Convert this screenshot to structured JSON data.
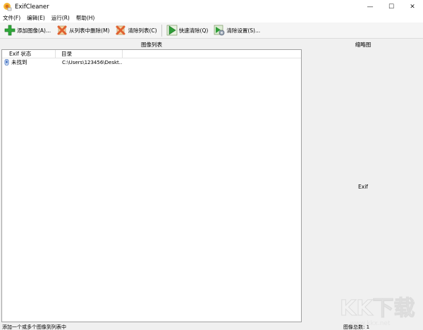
{
  "window": {
    "title": "ExifCleaner",
    "controls": {
      "minimize": "—",
      "maximize": "☐",
      "close": "✕"
    }
  },
  "menu": {
    "items": [
      {
        "label": "文件(F)"
      },
      {
        "label": "编辑(E)"
      },
      {
        "label": "运行(R)"
      },
      {
        "label": "帮助(H)"
      }
    ]
  },
  "toolbar": {
    "add_label": "添加图像(A)...",
    "remove_label": "从列表中删除(M)",
    "clear_list_label": "清除列表(C)",
    "quick_clean_label": "快速清除(Q)",
    "clean_settings_label": "清除设置(S)...",
    "icons": {
      "add": "plus-icon",
      "remove": "x-icon",
      "clear_list": "x-icon",
      "quick_clean": "play-icon",
      "clean_settings": "settings-icon"
    },
    "colors": {
      "add": "#2fa83a",
      "remove": "#e06030",
      "quick_clean": "#2f9e38"
    }
  },
  "image_list": {
    "title": "图像列表",
    "columns": [
      {
        "label": "Exif 状态"
      },
      {
        "label": "目录"
      }
    ],
    "rows": [
      {
        "status": "未找到",
        "directory": "C:\\Users\\123456\\Deskt..."
      }
    ]
  },
  "thumbnail": {
    "title": "缩略图",
    "content": "Exif"
  },
  "status": {
    "hint": "添加一个或多个图像到列表中",
    "count": "图像总数: 1"
  }
}
